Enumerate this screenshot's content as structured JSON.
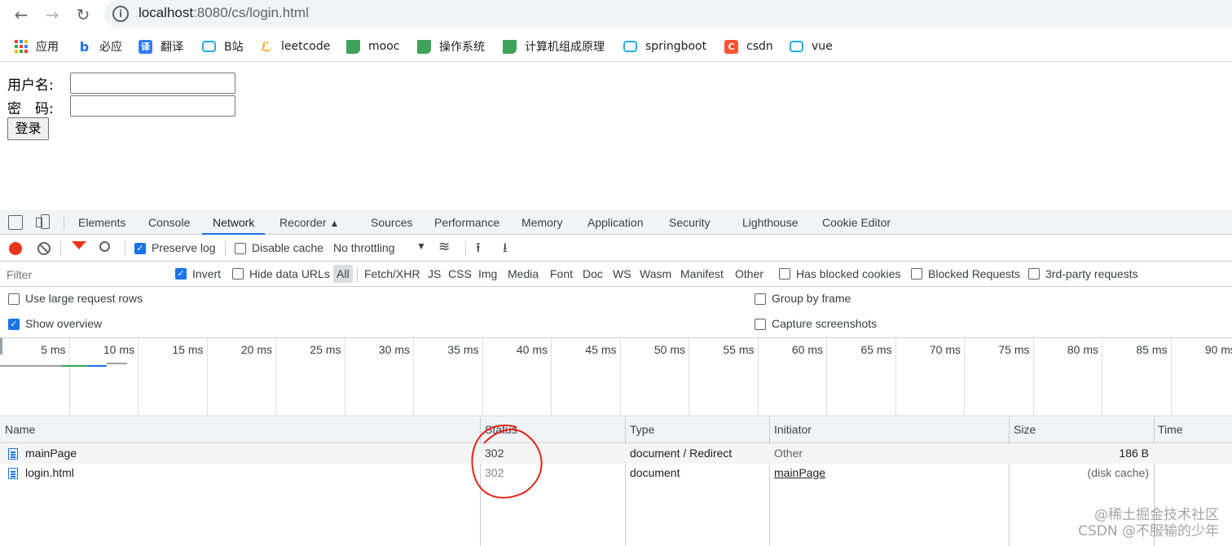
{
  "browser": {
    "url_host": "localhost",
    "url_rest": ":8080/cs/login.html",
    "bookmarks": [
      {
        "label": "应用",
        "icon": "apps-grid-icon",
        "color": "#ea4335"
      },
      {
        "label": "必应",
        "icon": "bing-icon",
        "color": "#1a73e8"
      },
      {
        "label": "翻译",
        "icon": "translate-icon",
        "color": "#2f7bf6"
      },
      {
        "label": "B站",
        "icon": "bilibili-icon",
        "color": "#23ade5"
      },
      {
        "label": "leetcode",
        "icon": "leetcode-icon",
        "color": "#f89f1b"
      },
      {
        "label": "mooc",
        "icon": "mooc-icon",
        "color": "#3fa35b"
      },
      {
        "label": "操作系统",
        "icon": "mooc-icon",
        "color": "#3fa35b"
      },
      {
        "label": "计算机组成原理",
        "icon": "mooc-icon",
        "color": "#3fa35b"
      },
      {
        "label": "springboot",
        "icon": "bilibili-icon",
        "color": "#23ade5"
      },
      {
        "label": "csdn",
        "icon": "csdn-icon",
        "color": "#fc5531"
      },
      {
        "label": "vue",
        "icon": "bilibili-icon",
        "color": "#23ade5"
      }
    ]
  },
  "page": {
    "username_label": "用户名:",
    "password_label": "密　码:",
    "username_value": "",
    "password_value": "",
    "login_label": "登录"
  },
  "devtools": {
    "tabs": [
      "Elements",
      "Console",
      "Network",
      "Recorder",
      "Sources",
      "Performance",
      "Memory",
      "Application",
      "Security",
      "Lighthouse",
      "Cookie Editor"
    ],
    "active_tab": "Network",
    "toolbar": {
      "preserve_log": "Preserve log",
      "disable_cache": "Disable cache",
      "throttling": "No throttling"
    },
    "filter": {
      "placeholder": "Filter",
      "invert": "Invert",
      "hide_data_urls": "Hide data URLs",
      "types": [
        "All",
        "Fetch/XHR",
        "JS",
        "CSS",
        "Img",
        "Media",
        "Font",
        "Doc",
        "WS",
        "Wasm",
        "Manifest",
        "Other"
      ],
      "has_blocked_cookies": "Has blocked cookies",
      "blocked_requests": "Blocked Requests",
      "third_party": "3rd-party requests"
    },
    "settings": {
      "large_rows": "Use large request rows",
      "show_overview": "Show overview",
      "group_by_frame": "Group by frame",
      "capture_screenshots": "Capture screenshots"
    },
    "timeline_ticks": [
      "5 ms",
      "10 ms",
      "15 ms",
      "20 ms",
      "25 ms",
      "30 ms",
      "35 ms",
      "40 ms",
      "45 ms",
      "50 ms",
      "55 ms",
      "60 ms",
      "65 ms",
      "70 ms",
      "75 ms",
      "80 ms",
      "85 ms",
      "90 ms"
    ],
    "table": {
      "headers": [
        "Name",
        "Status",
        "Type",
        "Initiator",
        "Size",
        "Time"
      ],
      "rows": [
        {
          "name": "mainPage",
          "status": "302",
          "type": "document / Redirect",
          "initiator": "Other",
          "size": "186 B"
        },
        {
          "name": "login.html",
          "status": "302",
          "type": "document",
          "initiator": "mainPage",
          "size": "(disk cache)"
        }
      ]
    }
  },
  "watermark": "@稀土掘金技术社区\nCSDN @不服输的少年"
}
